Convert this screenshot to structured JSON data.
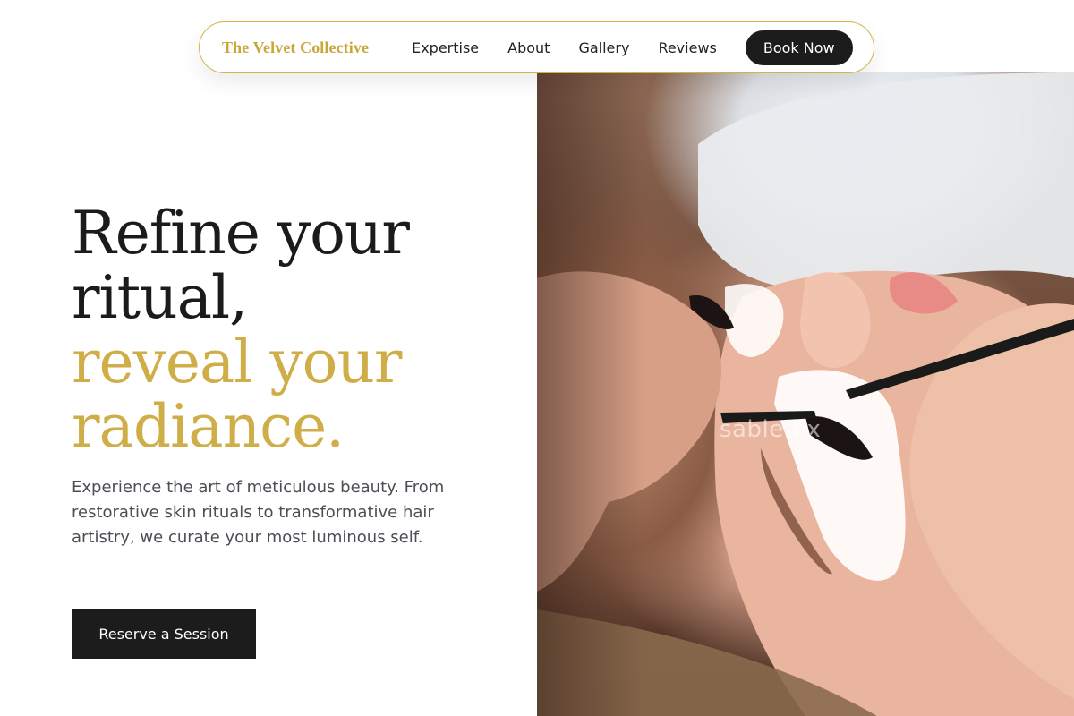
{
  "nav": {
    "brand": "The Velvet Collective",
    "links": [
      {
        "label": "Expertise"
      },
      {
        "label": "About"
      },
      {
        "label": "Gallery"
      },
      {
        "label": "Reviews"
      }
    ],
    "cta": "Book Now"
  },
  "hero": {
    "headline": {
      "line1": "Refine your",
      "line2": "ritual,",
      "line3": "reveal your",
      "line4": "radiance."
    },
    "subtext": "Experience the art of meticulous beauty. From restorative skin rituals to transformative hair artistry, we curate your most luminous self.",
    "cta": "Reserve a Session",
    "image_watermark": "sable.bx"
  },
  "colors": {
    "accent_gold": "#cfae48",
    "dark": "#1c1c1c",
    "body_text": "#4a4e55"
  }
}
